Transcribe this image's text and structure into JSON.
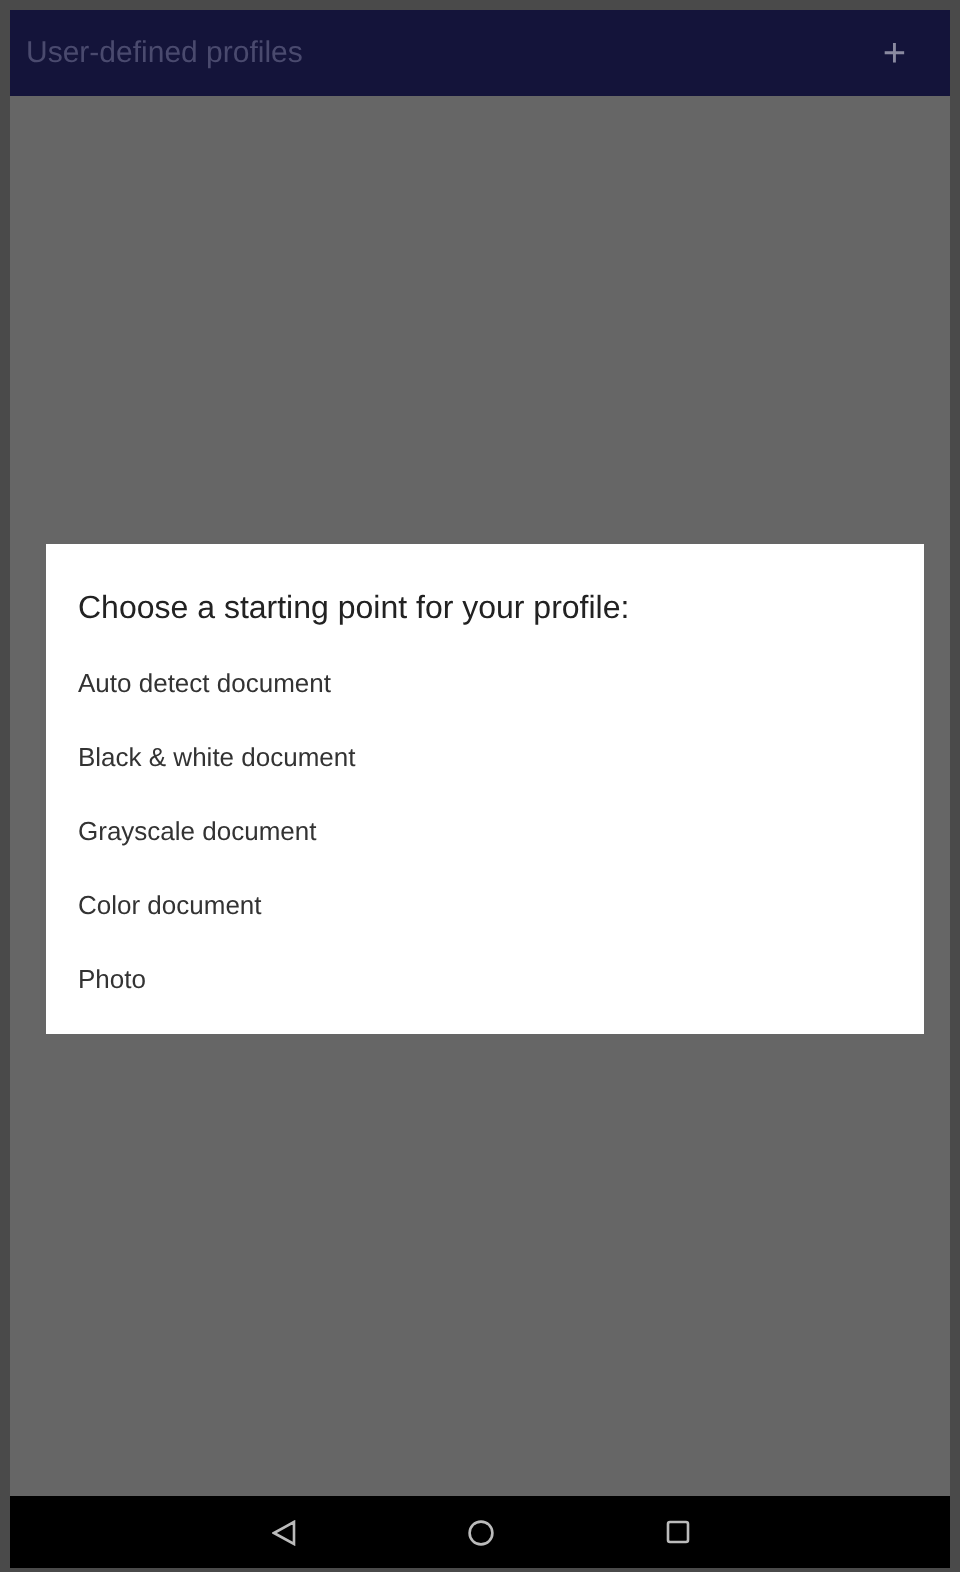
{
  "app_bar": {
    "title": "User-defined profiles",
    "add_button": "+"
  },
  "dialog": {
    "title": "Choose a starting point for your profile:",
    "options": [
      "Auto detect document",
      "Black & white document",
      "Grayscale document",
      "Color document",
      "Photo"
    ]
  }
}
